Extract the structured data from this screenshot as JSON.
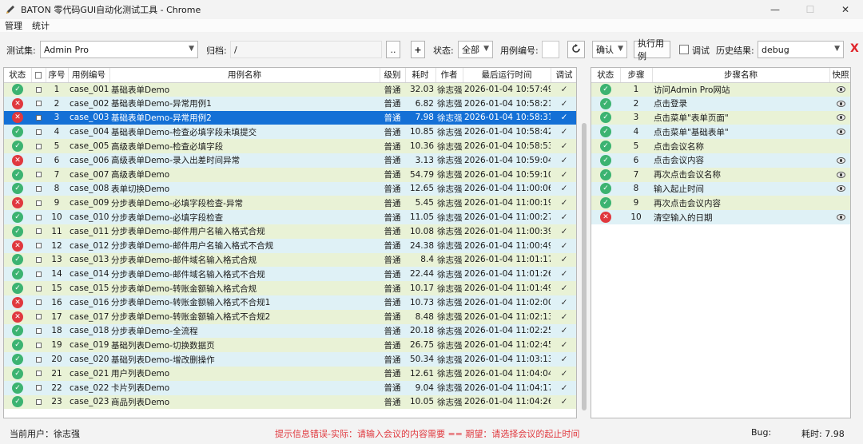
{
  "window": {
    "title": "BATON 零代码GUI自动化测试工具 - Chrome",
    "minimize": "—",
    "maximize": "☐",
    "close": "✕"
  },
  "menu": [
    "管理",
    "统计"
  ],
  "toolbar": {
    "suite_label": "测试集:",
    "suite_value": "Admin Pro",
    "archive_label": "归档:",
    "archive_value": "/",
    "browse_label": "..",
    "add_label": "+",
    "status_label": "状态:",
    "status_value": "全部",
    "case_no_label": "用例编号:",
    "case_no_value": "",
    "confirm_value": "确认",
    "run_label": "执行用例",
    "debug_label": "调试",
    "history_label": "历史结果:",
    "history_value": "debug",
    "clear_label": "X"
  },
  "cases": {
    "headers": [
      "状态",
      "□",
      "序号",
      "用例编号",
      "用例名称",
      "级别",
      "耗时",
      "作者",
      "最后运行时间",
      "调试"
    ],
    "selected_index": 2,
    "rows": [
      {
        "status": "pass",
        "no": "1",
        "id": "case_001",
        "name": "基础表单Demo",
        "level": "普通",
        "time": "32.03",
        "author": "徐志强",
        "last_run": "2026-01-04 10:57:49",
        "debug": "✓"
      },
      {
        "status": "fail",
        "no": "2",
        "id": "case_002",
        "name": "基础表单Demo-异常用例1",
        "level": "普通",
        "time": "6.82",
        "author": "徐志强",
        "last_run": "2026-01-04 10:58:21",
        "debug": "✓"
      },
      {
        "status": "fail",
        "no": "3",
        "id": "case_003",
        "name": "基础表单Demo-异常用例2",
        "level": "普通",
        "time": "7.98",
        "author": "徐志强",
        "last_run": "2026-01-04 10:58:31",
        "debug": "✓"
      },
      {
        "status": "pass",
        "no": "4",
        "id": "case_004",
        "name": "基础表单Demo-检查必填字段未填提交",
        "level": "普通",
        "time": "10.85",
        "author": "徐志强",
        "last_run": "2026-01-04 10:58:42",
        "debug": "✓"
      },
      {
        "status": "pass",
        "no": "5",
        "id": "case_005",
        "name": "高级表单Demo-检查必填字段",
        "level": "普通",
        "time": "10.36",
        "author": "徐志强",
        "last_run": "2026-01-04 10:58:53",
        "debug": "✓"
      },
      {
        "status": "fail",
        "no": "6",
        "id": "case_006",
        "name": "高级表单Demo-录入出差时间异常",
        "level": "普通",
        "time": "3.13",
        "author": "徐志强",
        "last_run": "2026-01-04 10:59:04",
        "debug": "✓"
      },
      {
        "status": "pass",
        "no": "7",
        "id": "case_007",
        "name": "高级表单Demo",
        "level": "普通",
        "time": "54.79",
        "author": "徐志强",
        "last_run": "2026-01-04 10:59:10",
        "debug": "✓"
      },
      {
        "status": "pass",
        "no": "8",
        "id": "case_008",
        "name": "表单切换Demo",
        "level": "普通",
        "time": "12.65",
        "author": "徐志强",
        "last_run": "2026-01-04 11:00:06",
        "debug": "✓"
      },
      {
        "status": "fail",
        "no": "9",
        "id": "case_009",
        "name": "分步表单Demo-必填字段检查-异常",
        "level": "普通",
        "time": "5.45",
        "author": "徐志强",
        "last_run": "2026-01-04 11:00:19",
        "debug": "✓"
      },
      {
        "status": "pass",
        "no": "10",
        "id": "case_010",
        "name": "分步表单Demo-必填字段检查",
        "level": "普通",
        "time": "11.05",
        "author": "徐志强",
        "last_run": "2026-01-04 11:00:27",
        "debug": "✓"
      },
      {
        "status": "pass",
        "no": "11",
        "id": "case_011",
        "name": "分步表单Demo-邮件用户名输入格式合规",
        "level": "普通",
        "time": "10.08",
        "author": "徐志强",
        "last_run": "2026-01-04 11:00:39",
        "debug": "✓"
      },
      {
        "status": "fail",
        "no": "12",
        "id": "case_012",
        "name": "分步表单Demo-邮件用户名输入格式不合规",
        "level": "普通",
        "time": "24.38",
        "author": "徐志强",
        "last_run": "2026-01-04 11:00:49",
        "debug": "✓"
      },
      {
        "status": "pass",
        "no": "13",
        "id": "case_013",
        "name": "分步表单Demo-邮件域名输入格式合规",
        "level": "普通",
        "time": "8.4",
        "author": "徐志强",
        "last_run": "2026-01-04 11:01:17",
        "debug": "✓"
      },
      {
        "status": "pass",
        "no": "14",
        "id": "case_014",
        "name": "分步表单Demo-邮件域名输入格式不合规",
        "level": "普通",
        "time": "22.44",
        "author": "徐志强",
        "last_run": "2026-01-04 11:01:26",
        "debug": "✓"
      },
      {
        "status": "pass",
        "no": "15",
        "id": "case_015",
        "name": "分步表单Demo-转账金额输入格式合规",
        "level": "普通",
        "time": "10.17",
        "author": "徐志强",
        "last_run": "2026-01-04 11:01:49",
        "debug": "✓"
      },
      {
        "status": "fail",
        "no": "16",
        "id": "case_016",
        "name": "分步表单Demo-转账金额输入格式不合规1",
        "level": "普通",
        "time": "10.73",
        "author": "徐志强",
        "last_run": "2026-01-04 11:02:00",
        "debug": "✓"
      },
      {
        "status": "fail",
        "no": "17",
        "id": "case_017",
        "name": "分步表单Demo-转账金额输入格式不合规2",
        "level": "普通",
        "time": "8.48",
        "author": "徐志强",
        "last_run": "2026-01-04 11:02:13",
        "debug": "✓"
      },
      {
        "status": "pass",
        "no": "18",
        "id": "case_018",
        "name": "分步表单Demo-全流程",
        "level": "普通",
        "time": "20.18",
        "author": "徐志强",
        "last_run": "2026-01-04 11:02:25",
        "debug": "✓"
      },
      {
        "status": "pass",
        "no": "19",
        "id": "case_019",
        "name": "基础列表Demo-切换数据页",
        "level": "普通",
        "time": "26.75",
        "author": "徐志强",
        "last_run": "2026-01-04 11:02:45",
        "debug": "✓"
      },
      {
        "status": "pass",
        "no": "20",
        "id": "case_020",
        "name": "基础列表Demo-增改删操作",
        "level": "普通",
        "time": "50.34",
        "author": "徐志强",
        "last_run": "2026-01-04 11:03:13",
        "debug": "✓"
      },
      {
        "status": "pass",
        "no": "21",
        "id": "case_021",
        "name": "用户列表Demo",
        "level": "普通",
        "time": "12.61",
        "author": "徐志强",
        "last_run": "2026-01-04 11:04:04",
        "debug": "✓"
      },
      {
        "status": "pass",
        "no": "22",
        "id": "case_022",
        "name": "卡片列表Demo",
        "level": "普通",
        "time": "9.04",
        "author": "徐志强",
        "last_run": "2026-01-04 11:04:17",
        "debug": "✓"
      },
      {
        "status": "pass",
        "no": "23",
        "id": "case_023",
        "name": "商品列表Demo",
        "level": "普通",
        "time": "10.05",
        "author": "徐志强",
        "last_run": "2026-01-04 11:04:26",
        "debug": "✓"
      }
    ]
  },
  "steps": {
    "headers": [
      "状态",
      "步骤",
      "步骤名称",
      "快照"
    ],
    "rows": [
      {
        "status": "pass",
        "no": "1",
        "name": "访问Admin Pro网站",
        "snapshot": true
      },
      {
        "status": "pass",
        "no": "2",
        "name": "点击登录",
        "snapshot": true
      },
      {
        "status": "pass",
        "no": "3",
        "name": "点击菜单\"表单页面\"",
        "snapshot": true
      },
      {
        "status": "pass",
        "no": "4",
        "name": "点击菜单\"基础表单\"",
        "snapshot": true
      },
      {
        "status": "pass",
        "no": "5",
        "name": "点击会议名称",
        "snapshot": false
      },
      {
        "status": "pass",
        "no": "6",
        "name": "点击会议内容",
        "snapshot": true
      },
      {
        "status": "pass",
        "no": "7",
        "name": "再次点击会议名称",
        "snapshot": true
      },
      {
        "status": "pass",
        "no": "8",
        "name": "输入起止时间",
        "snapshot": true
      },
      {
        "status": "pass",
        "no": "9",
        "name": "再次点击会议内容",
        "snapshot": false
      },
      {
        "status": "fail",
        "no": "10",
        "name": "清空输入的日期",
        "snapshot": true
      }
    ]
  },
  "statusbar": {
    "user": "当前用户：徐志强",
    "message": "提示信息错误-实际：请输入会议的内容需要 == 期望：请选择会议的起止时间",
    "bug_label": "Bug:",
    "time_label": "耗时: 7.98"
  },
  "colors": {
    "pass": "#3cb371",
    "fail": "#e0383e",
    "selected_row": "#1470d6",
    "message_red": "#e0383e",
    "clear_red": "#e0242a"
  }
}
